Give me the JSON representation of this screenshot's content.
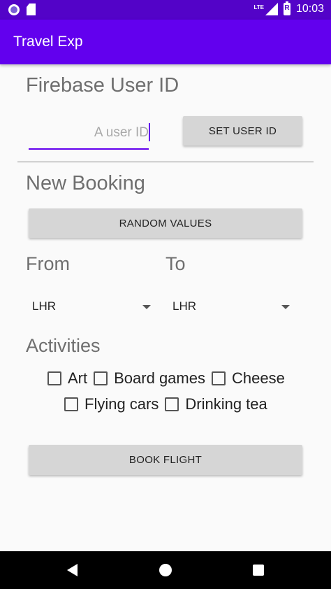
{
  "status_bar": {
    "network_label": "LTE",
    "battery_label": "R",
    "time": "10:03",
    "icons": [
      "app-notification-icon",
      "sd-card-icon",
      "lte-signal-icon",
      "battery-icon"
    ]
  },
  "app_bar": {
    "title": "Travel Exp"
  },
  "user_section": {
    "title": "Firebase User ID",
    "user_id_value": "",
    "user_id_placeholder": "A user ID",
    "set_user_button": "SET USER ID"
  },
  "booking": {
    "title": "New Booking",
    "random_button": "RANDOM VALUES",
    "from_label": "From",
    "to_label": "To",
    "from_value": "LHR",
    "to_value": "LHR"
  },
  "activities": {
    "title": "Activities",
    "items": [
      {
        "label": "Art",
        "checked": false
      },
      {
        "label": "Board games",
        "checked": false
      },
      {
        "label": "Cheese",
        "checked": false
      },
      {
        "label": "Flying cars",
        "checked": false
      },
      {
        "label": "Drinking tea",
        "checked": false
      }
    ]
  },
  "book_button": "BOOK FLIGHT",
  "colors": {
    "status_bar": "#5303c8",
    "app_bar": "#6200ee",
    "accent": "#6200ee",
    "button": "#d6d6d6",
    "background": "#fafafa"
  }
}
